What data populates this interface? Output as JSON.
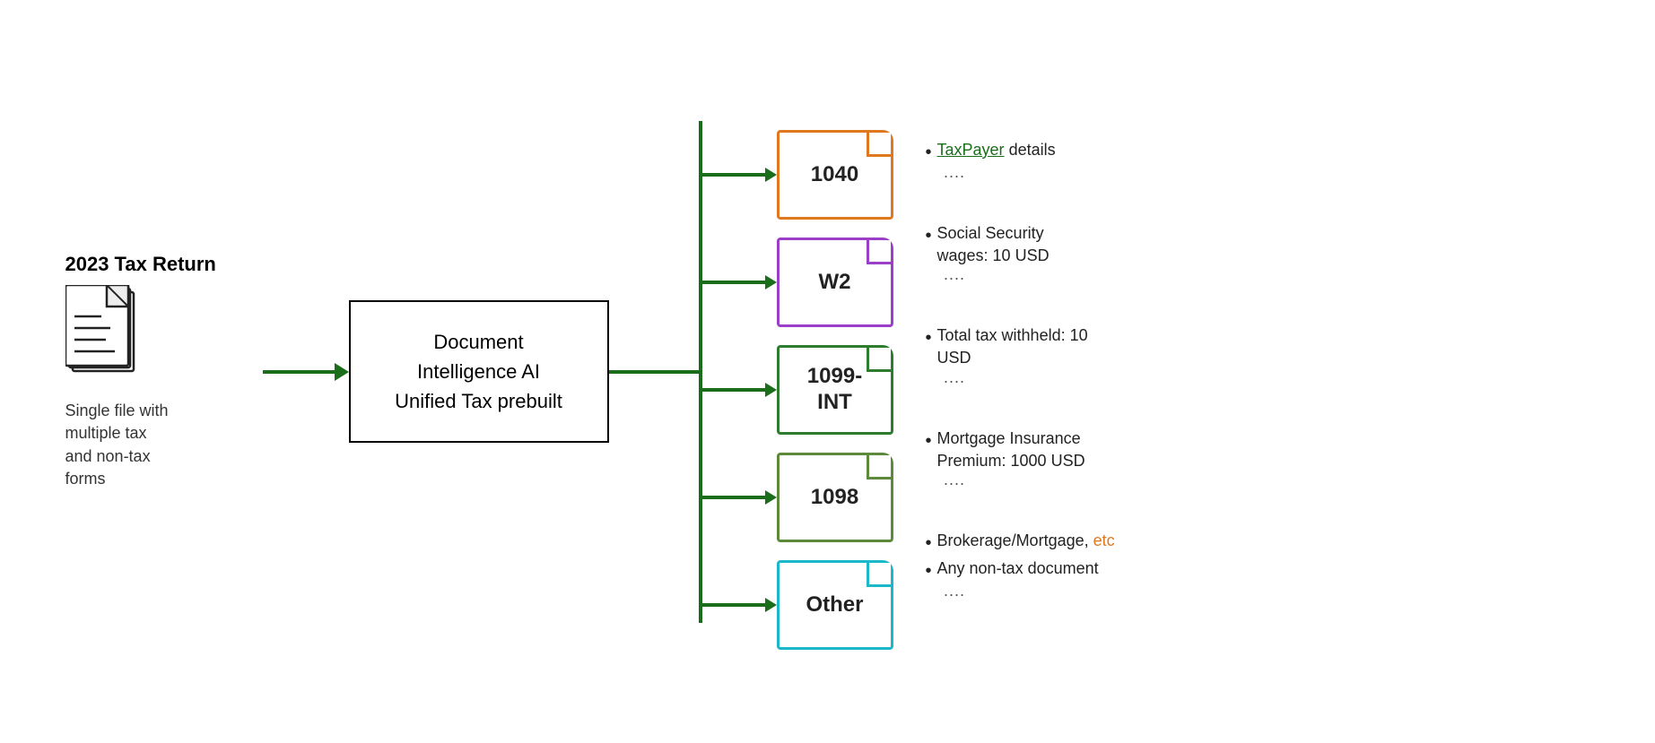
{
  "diagram": {
    "doc_title": "2023 Tax Return",
    "doc_label": "Single file with\nmultiple tax\nand non-tax\nforms",
    "center_box_line1": "Document Intelligence AI",
    "center_box_line2": "Unified Tax prebuilt",
    "form_cards": [
      {
        "id": "1040",
        "label": "1040",
        "color_class": "card-1040"
      },
      {
        "id": "w2",
        "label": "W2",
        "color_class": "card-w2"
      },
      {
        "id": "1099-int",
        "label": "1099-\nINT",
        "color_class": "card-1099"
      },
      {
        "id": "1098",
        "label": "1098",
        "color_class": "card-1098"
      },
      {
        "id": "other",
        "label": "Other",
        "color_class": "card-other"
      }
    ],
    "info_groups": [
      {
        "items": [
          {
            "text": "TaxPayer details",
            "link": true,
            "link_word": "TaxPayer"
          },
          {
            "text": "...."
          }
        ]
      },
      {
        "items": [
          {
            "text": "Social Security wages: 10 USD"
          },
          {
            "text": "...."
          }
        ]
      },
      {
        "items": [
          {
            "text": "Total tax withheld: 10 USD"
          },
          {
            "text": "...."
          }
        ]
      },
      {
        "items": [
          {
            "text": "Mortgage Insurance Premium: 1000 USD"
          },
          {
            "text": "...."
          }
        ]
      },
      {
        "items": [
          {
            "text": " Brokerage/Mortgage, etc",
            "orange": true
          },
          {
            "text": " Any non-tax document"
          },
          {
            "text": "...."
          }
        ]
      }
    ]
  }
}
